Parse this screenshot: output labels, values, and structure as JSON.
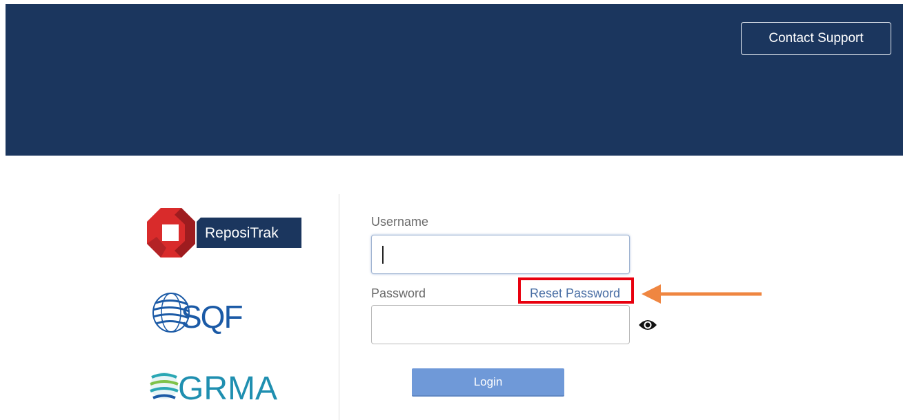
{
  "header": {
    "contact_support_label": "Contact Support",
    "background_color": "#1b365e"
  },
  "logos": {
    "repositrak": {
      "text": "ReposiTrak",
      "icon": "repositrak-logo"
    },
    "sqf": {
      "text": "SQF",
      "icon": "sqf-globe-logo"
    },
    "grma": {
      "text": "GRMA",
      "icon": "grma-globe-logo"
    }
  },
  "form": {
    "username_label": "Username",
    "username_value": "",
    "password_label": "Password",
    "password_value": "",
    "reset_password_label": "Reset Password",
    "show_password_icon": "eye-icon",
    "login_label": "Login"
  },
  "annotations": {
    "highlight_color": "#e8000e",
    "arrow_color": "#ef8641"
  },
  "colors": {
    "link": "#4a6fa5",
    "login_button": "#6f99d8"
  }
}
